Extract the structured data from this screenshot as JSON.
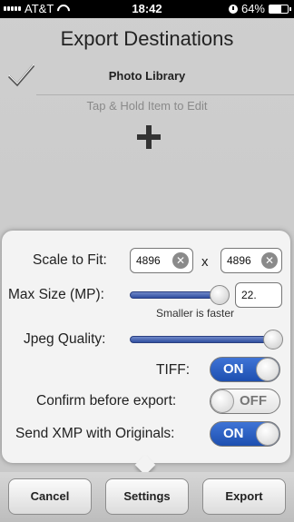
{
  "status_bar": {
    "carrier": "AT&T",
    "time": "18:42",
    "battery": "64%",
    "battery_level": 0.64
  },
  "header": {
    "title": "Export Destinations"
  },
  "destinations": [
    {
      "label": "Photo Library",
      "checked": true
    }
  ],
  "hint": "Tap & Hold Item to Edit",
  "settings": {
    "scale_label": "Scale to Fit:",
    "scale_width": "4896",
    "scale_separator": "x",
    "scale_height": "4896",
    "max_size_label": "Max Size (MP):",
    "max_size_value": "22.",
    "max_size_slider_fraction": 1.0,
    "max_size_note": "Smaller is faster",
    "jpeg_quality_label": "Jpeg Quality:",
    "jpeg_quality_fraction": 1.0,
    "tiff_label": "TIFF:",
    "tiff_state": "ON",
    "confirm_label": "Confirm before export:",
    "confirm_state": "OFF",
    "xmp_label": "Send XMP with Originals:",
    "xmp_state": "ON"
  },
  "toolbar": {
    "cancel": "Cancel",
    "settings": "Settings",
    "export": "Export"
  },
  "colors": {
    "accent": "#2a5fc4",
    "background": "#cbcbcb"
  }
}
